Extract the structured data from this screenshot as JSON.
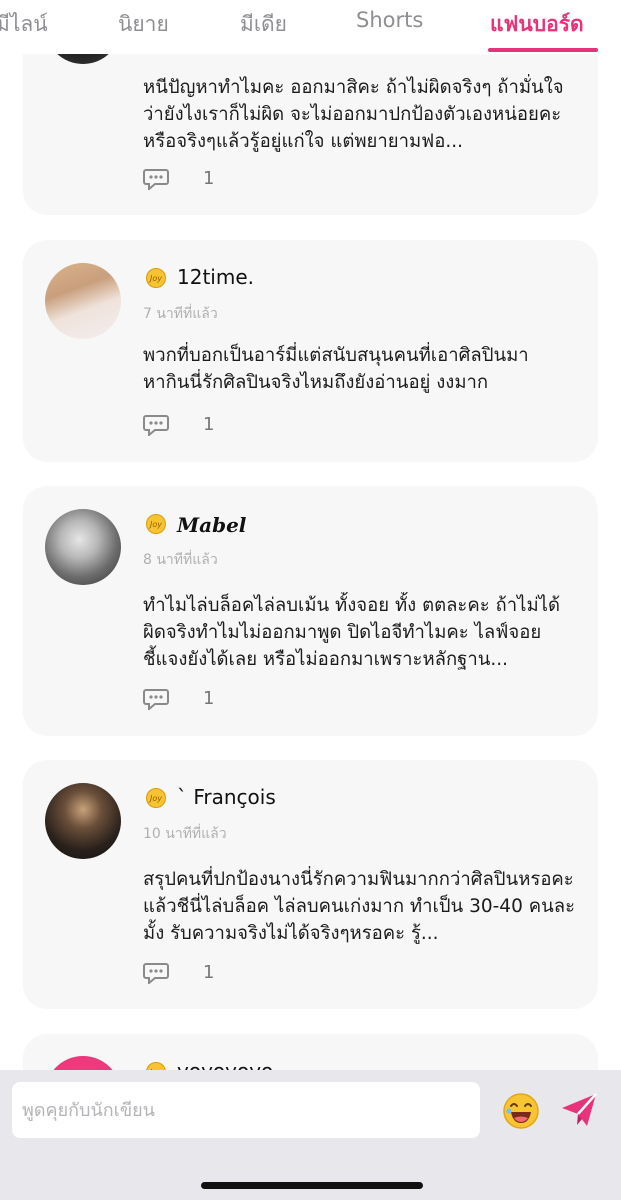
{
  "tabs": [
    {
      "label": "มีไลน์"
    },
    {
      "label": "นิยาย"
    },
    {
      "label": "มีเดีย"
    },
    {
      "label": "Shorts"
    },
    {
      "label": "แฟนบอร์ด"
    }
  ],
  "active_tab": "แฟนบอร์ด",
  "accent_color": "#e8337a",
  "coin_label": "Joy",
  "comments": [
    {
      "username": "",
      "time": "",
      "text": "หนีปัญหาทำไมคะ ออกมาสิคะ ถ้าไม่ผิดจริงๆ ถ้ามั่นใจว่ายังไงเราก็ไม่ผิด จะไม่ออกมาปกป้องตัวเองหน่อยคะ หรือจริงๆแล้วรู้อยู่แก่ใจ แต่พยายามฟอ...",
      "replies": "1"
    },
    {
      "username": "12time.",
      "time": "7 นาทีที่แล้ว",
      "text": "พวกที่บอกเป็นอาร์มี่แต่สนับสนุนคนที่เอาศิลปินมาหากินนี่รักศิลปินจริงไหมถึงยังอ่านอยู่ งงมาก",
      "replies": "1"
    },
    {
      "username": "Mabel",
      "time": "8 นาทีที่แล้ว",
      "text": "ทำไมไล่บล็อคไล่ลบเม้น ทั้งจอย ทั้ง ตตละคะ ถ้าไม่ได้ผิดจริงทำไมไม่ออกมาพูด ปิดไอจีทำไมคะ ไลฟ์จอยชี้แจงยังได้เลย หรือไม่ออกมาเพราะหลักฐาน...",
      "replies": "1"
    },
    {
      "username": "` François",
      "time": "10 นาทีที่แล้ว",
      "text": "สรุปคนที่ปกป้องนางนี่รักความฟินมากกว่าศิลปินหรอคะ แล้วชีนี่ไล่บล็อค ไล่ลบคนเก่งมาก ทำเป็น 30-40 คนละมั้ง รับความจริงไม่ได้จริงๆหรอคะ รู้...",
      "replies": "1"
    },
    {
      "username": "yoyoyoyo",
      "time": "",
      "text": "",
      "replies": ""
    }
  ],
  "chat": {
    "placeholder": "พูดคุยกับนักเขียน",
    "value": ""
  }
}
